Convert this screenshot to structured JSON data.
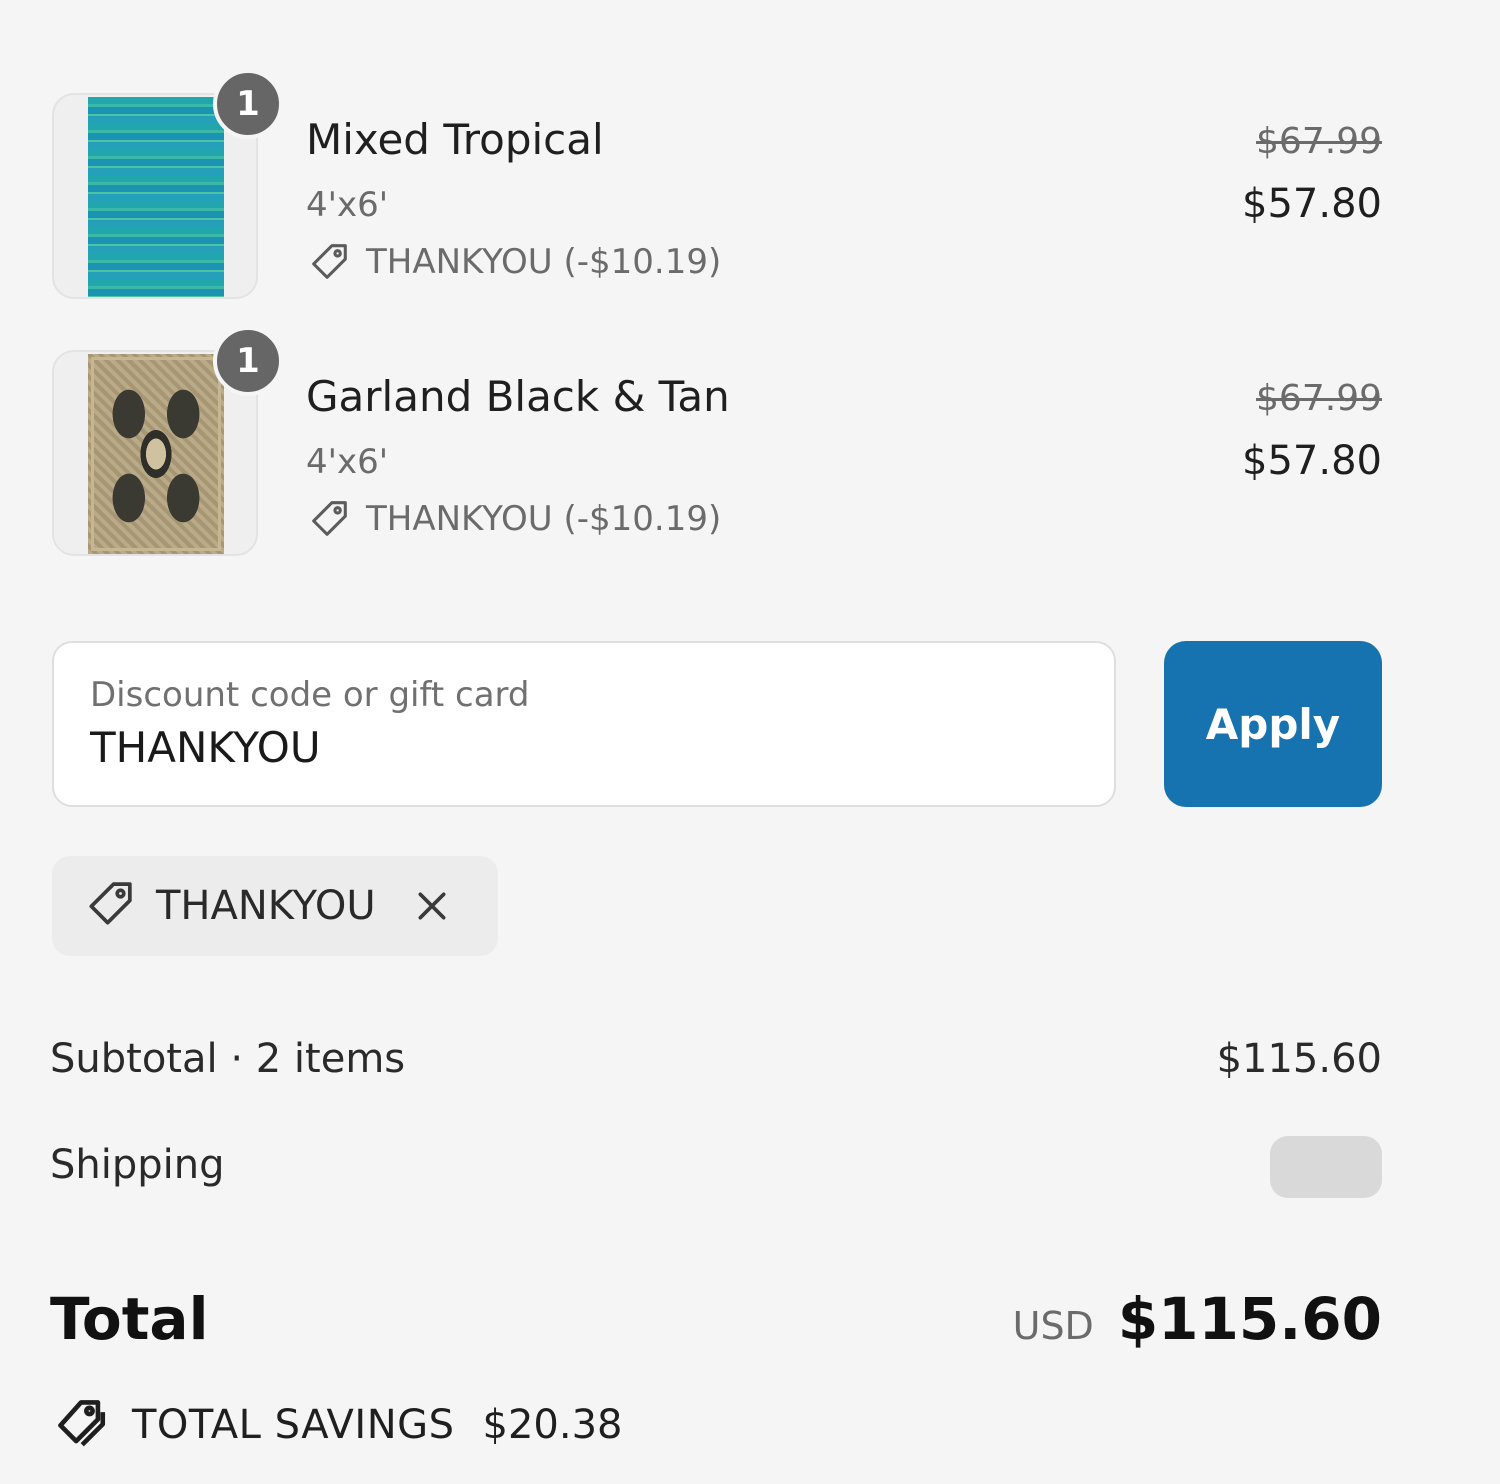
{
  "line_items": [
    {
      "quantity": "1",
      "name": "Mixed Tropical",
      "variant": "4'x6'",
      "discount": "THANKYOU (-$10.19)",
      "compare_price": "$67.99",
      "price": "$57.80"
    },
    {
      "quantity": "1",
      "name": "Garland Black & Tan",
      "variant": "4'x6'",
      "discount": "THANKYOU (-$10.19)",
      "compare_price": "$67.99",
      "price": "$57.80"
    }
  ],
  "discount_form": {
    "label": "Discount code or gift card",
    "value": "THANKYOU",
    "apply_label": "Apply"
  },
  "applied_code": {
    "code": "THANKYOU"
  },
  "summary": {
    "subtotal_label": "Subtotal · 2 items",
    "subtotal_value": "$115.60",
    "shipping_label": "Shipping",
    "total_label": "Total",
    "currency": "USD",
    "total_value": "$115.60",
    "savings_label": "TOTAL SAVINGS",
    "savings_value": "$20.38"
  },
  "colors": {
    "accent": "#1773b0",
    "badge": "#666666",
    "background": "#f5f5f5"
  },
  "icons": [
    "tag-icon",
    "close-icon",
    "tags-icon"
  ]
}
